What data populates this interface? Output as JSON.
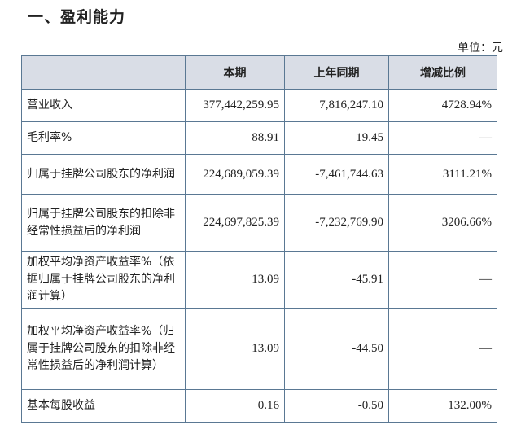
{
  "section_title": "一、盈利能力",
  "unit_label": "单位：元",
  "headers": [
    "",
    "本期",
    "上年同期",
    "增减比例"
  ],
  "rows": [
    {
      "item": "营业收入",
      "current": "377,442,259.95",
      "prior": "7,816,247.10",
      "change": "4728.94%"
    },
    {
      "item": "毛利率%",
      "current": "88.91",
      "prior": "19.45",
      "change": "—"
    },
    {
      "item": "归属于挂牌公司股东的净利润",
      "current": "224,689,059.39",
      "prior": "-7,461,744.63",
      "change": "3111.21%"
    },
    {
      "item": "归属于挂牌公司股东的扣除非经常性损益后的净利润",
      "current": "224,697,825.39",
      "prior": "-7,232,769.90",
      "change": "3206.66%"
    },
    {
      "item": "加权平均净资产收益率%（依据归属于挂牌公司股东的净利润计算）",
      "current": "13.09",
      "prior": "-45.91",
      "change": "—"
    },
    {
      "item": "加权平均净资产收益率%（归属于挂牌公司股东的扣除非经常性损益后的净利润计算）",
      "current": "13.09",
      "prior": "-44.50",
      "change": "—"
    },
    {
      "item": "基本每股收益",
      "current": "0.16",
      "prior": "-0.50",
      "change": "132.00%"
    }
  ]
}
